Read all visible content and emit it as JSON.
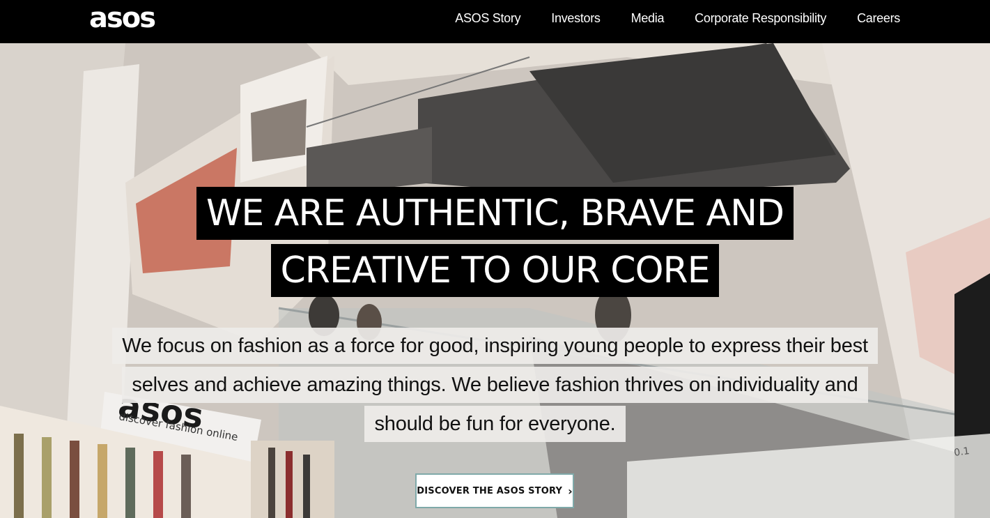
{
  "header": {
    "logo_text": "asos",
    "nav": [
      {
        "label": "ASOS Story"
      },
      {
        "label": "Investors"
      },
      {
        "label": "Media"
      },
      {
        "label": "Corporate Responsibility"
      },
      {
        "label": "Careers"
      }
    ]
  },
  "hero": {
    "headline_lines": [
      "WE ARE AUTHENTIC, BRAVE AND",
      "CREATIVE TO OUR CORE"
    ],
    "body_lines": [
      "We focus on fashion as a force for good, inspiring young people to express their best",
      "selves and achieve amazing things. We believe fashion thrives on individuality and",
      "should be fun for everyone."
    ],
    "cta_label": "DISCOVER THE ASOS STORY",
    "cta_icon": "chevron-right-icon",
    "background_sign_text": "asos",
    "background_sign_tagline": "discover fashion online",
    "background_wall_text": "0.1"
  },
  "colors": {
    "header_bg": "#000000",
    "headline_bg": "#000000",
    "headline_text": "#ffffff",
    "body_bg": "#eeece9",
    "cta_border": "#7fa9a9"
  }
}
